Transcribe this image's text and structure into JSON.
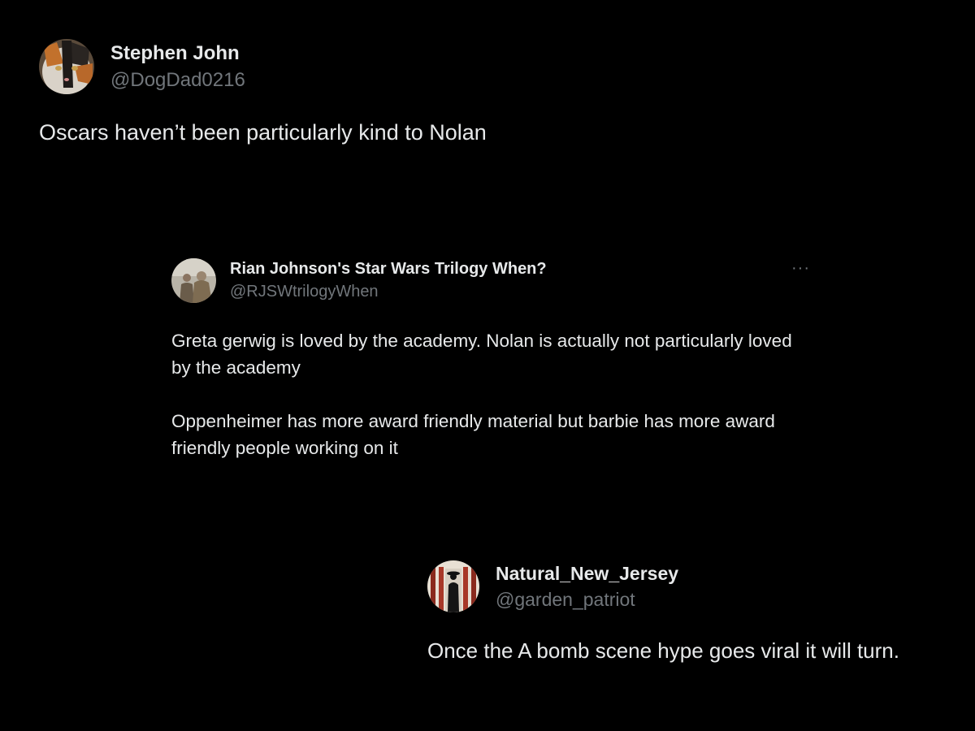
{
  "tweets": [
    {
      "display_name": "Stephen John",
      "handle": "@DogDad0216",
      "text": "Oscars haven’t been particularly kind to Nolan",
      "avatar_icon": "calico-cat-avatar"
    },
    {
      "display_name": "Rian Johnson's Star Wars Trilogy When?",
      "handle": "@RJSWtrilogyWhen",
      "text": "Greta gerwig is loved by the academy. Nolan is actually not particularly loved by the academy\n\nOppenheimer has more award friendly material but barbie has more award friendly people working on it",
      "avatar_icon": "two-figures-avatar",
      "more_label": "···"
    },
    {
      "display_name": "Natural_New_Jersey",
      "handle": "@garden_patriot",
      "text": "Once the A bomb scene hype goes viral it will turn.",
      "avatar_icon": "silhouette-doorway-avatar"
    }
  ],
  "colors": {
    "background": "#000000",
    "primary_text": "#e7e9ea",
    "secondary_text": "#71767b"
  }
}
